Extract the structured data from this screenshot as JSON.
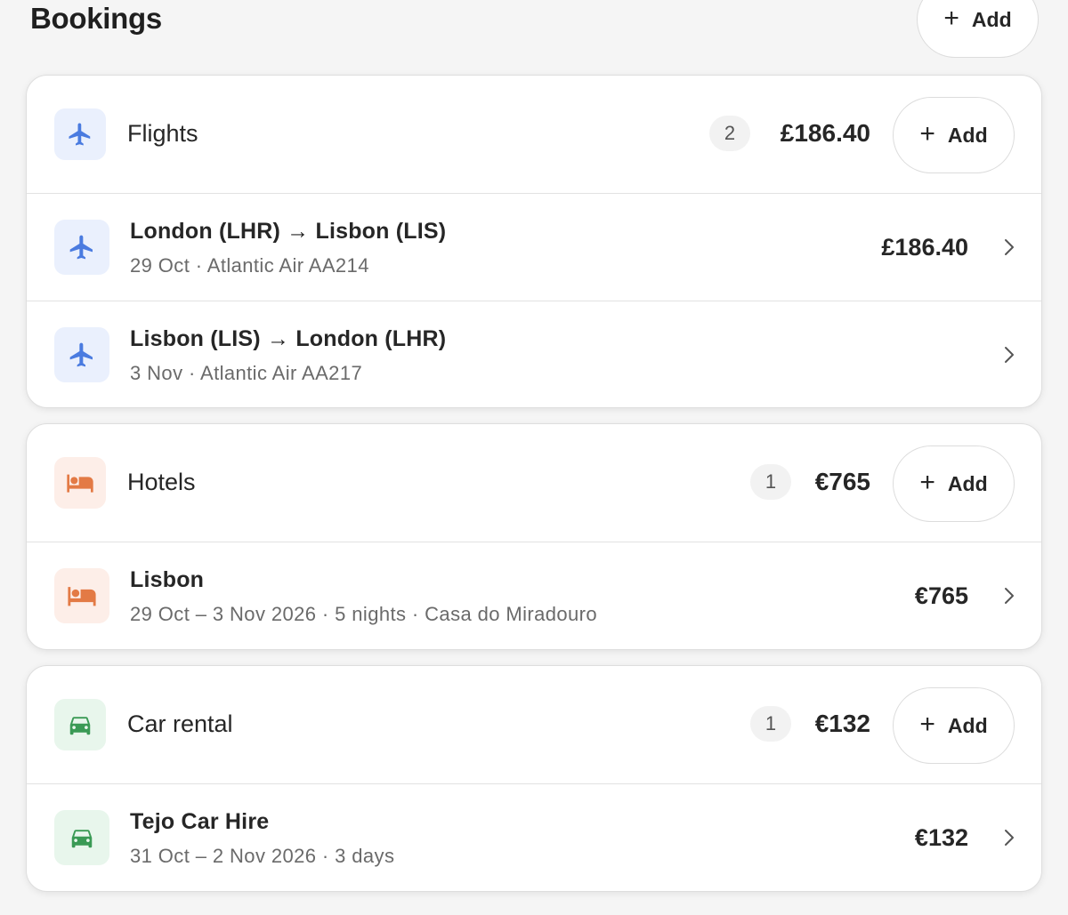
{
  "page": {
    "title": "Bookings",
    "add_label": "Add",
    "add_icon": "+"
  },
  "colors": {
    "flight_accent": "#4a7be0",
    "hotel_accent": "#e37a45",
    "car_accent": "#3a9a55"
  },
  "sections": [
    {
      "id": "flights",
      "title": "Flights",
      "icon": "airplane-icon",
      "count": "2",
      "total": "£186.40",
      "add_label": "Add",
      "add_icon": "+",
      "items": [
        {
          "title": "London (LHR) → Lisbon (LIS)",
          "subtitle": "29 Oct · Atlantic Air AA214",
          "price": "£186.40"
        },
        {
          "title": "Lisbon (LIS) → London (LHR)",
          "subtitle": "3 Nov · Atlantic Air AA217",
          "price": ""
        }
      ]
    },
    {
      "id": "hotels",
      "title": "Hotels",
      "icon": "bed-icon",
      "count": "1",
      "total": "€765",
      "add_label": "Add",
      "add_icon": "+",
      "items": [
        {
          "title": "Lisbon",
          "subtitle": "29 Oct – 3 Nov 2026 · 5 nights · Casa do Miradouro",
          "price": "€765"
        }
      ]
    },
    {
      "id": "car-rental",
      "title": "Car rental",
      "icon": "car-icon",
      "count": "1",
      "total": "€132",
      "add_label": "Add",
      "add_icon": "+",
      "items": [
        {
          "title": "Tejo Car Hire",
          "subtitle": "31 Oct – 2 Nov 2026 · 3 days",
          "price": "€132"
        }
      ]
    }
  ]
}
